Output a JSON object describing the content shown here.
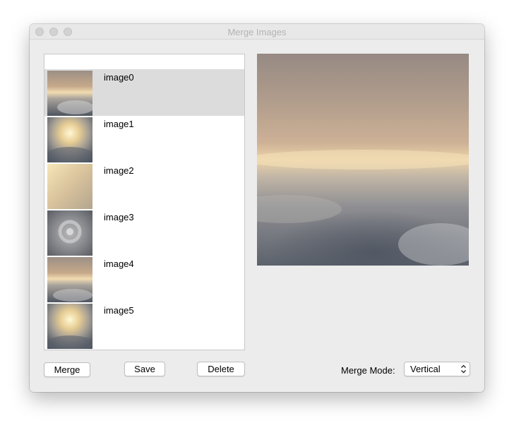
{
  "window": {
    "title": "Merge Images"
  },
  "image_list": {
    "items": [
      {
        "label": "image0",
        "thumb": "clouds-horizon-icon"
      },
      {
        "label": "image1",
        "thumb": "clouds-sunburst-icon"
      },
      {
        "label": "image2",
        "thumb": "sunlit-sky-icon"
      },
      {
        "label": "image3",
        "thumb": "cloud-swirl-icon"
      },
      {
        "label": "image4",
        "thumb": "clouds-horizon-icon"
      },
      {
        "label": "image5",
        "thumb": "clouds-sunburst-icon"
      }
    ],
    "selected": "image0"
  },
  "buttons": {
    "merge": "Merge",
    "save": "Save",
    "delete": "Delete"
  },
  "merge_mode": {
    "label": "Merge Mode:",
    "value": "Vertical"
  },
  "preview": {
    "icon": "clouds-horizon-icon"
  },
  "colors": {
    "window_bg": "#ececec",
    "selection": "#dcdcdc",
    "title_text": "#b3b3b3"
  }
}
